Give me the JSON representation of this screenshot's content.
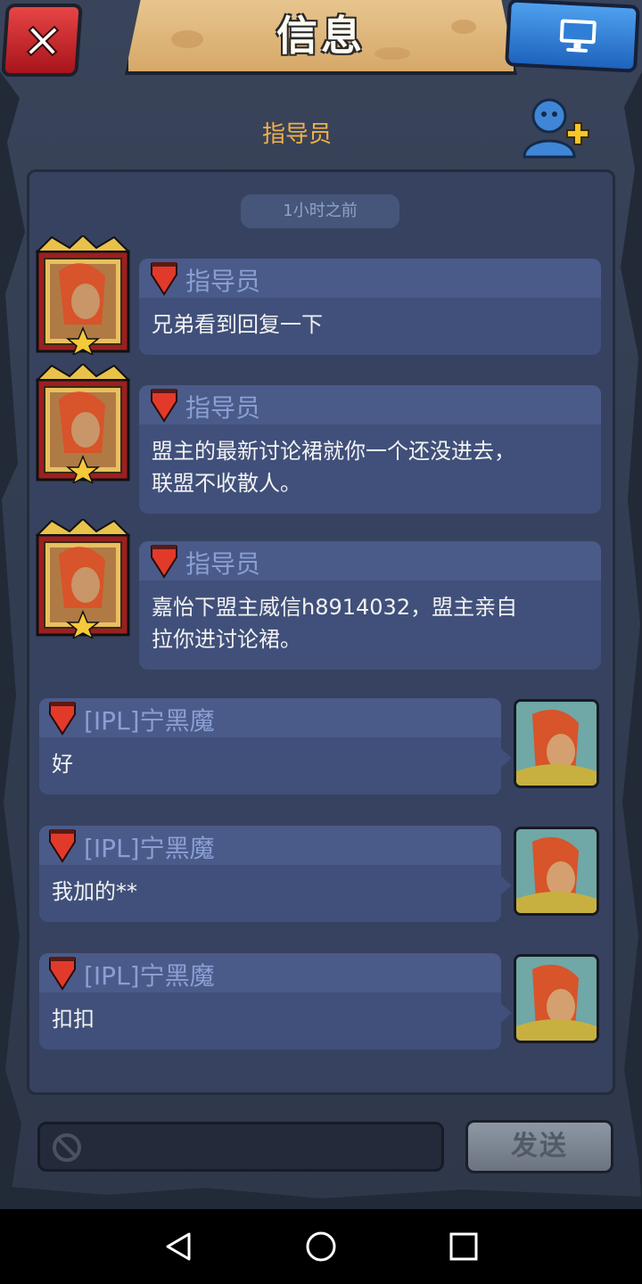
{
  "window": {
    "title": "信息"
  },
  "header": {
    "label": "指导员"
  },
  "chat": {
    "time_divider": "1小时之前",
    "messages": [
      {
        "side": "left",
        "name": "指导员",
        "text": "兄弟看到回复一下"
      },
      {
        "side": "left",
        "name": "指导员",
        "text": "盟主的最新讨论裙就你一个还没进去，\n联盟不收散人。"
      },
      {
        "side": "left",
        "name": "指导员",
        "text": "嘉怡下盟主威信h8914032，盟主亲自\n拉你进讨论裙。"
      },
      {
        "side": "right",
        "name": "[IPL]宁黑魔",
        "text": "好"
      },
      {
        "side": "right",
        "name": "[IPL]宁黑魔",
        "text": "我加的**"
      },
      {
        "side": "right",
        "name": "[IPL]宁黑魔",
        "text": "扣扣"
      }
    ]
  },
  "input": {
    "value": "",
    "placeholder": ""
  },
  "send_button": {
    "label": "发送"
  },
  "icons": {
    "close": "close-icon",
    "screen": "monitor-icon",
    "add_friend": "add-friend-icon",
    "blocked": "no-entry-icon",
    "flag": "flag-icon"
  },
  "colors": {
    "accent": "#f0b04a",
    "close_red": "#d42a2f",
    "screen_blue": "#2f7fd6",
    "bubble": "#40507a",
    "name_text": "#8a9fd2"
  },
  "navbar": {
    "back": "back-icon",
    "home": "home-icon",
    "recents": "recents-icon"
  }
}
